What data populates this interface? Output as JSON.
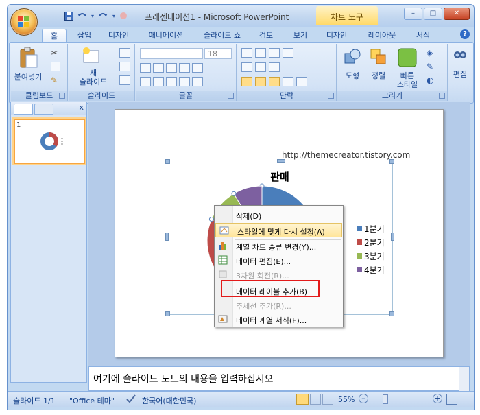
{
  "app": {
    "title": "프레젠테이션1 - Microsoft PowerPoint",
    "context_tab_title": "차트 도구",
    "win_min": "–",
    "win_max": "□",
    "win_close": "✕"
  },
  "tabs": [
    "홈",
    "삽입",
    "디자인",
    "애니메이션",
    "슬라이드 쇼",
    "검토",
    "보기",
    "디자인",
    "레이아웃",
    "서식"
  ],
  "ribbon": {
    "paste_label": "붙여넣기",
    "new_slide_label_1": "새",
    "new_slide_label_2": "슬라이드",
    "font_size_value": "18",
    "shape_label": "도형",
    "arrange_label": "정렬",
    "quick_style_label_1": "빠른",
    "quick_style_label_2": "스타일",
    "edit_label": "편집",
    "groups": {
      "clipboard": "클립보드",
      "slides": "슬라이드",
      "font": "글꼴",
      "paragraph": "단락",
      "drawing": "그리기"
    }
  },
  "slide_pane": {
    "close": "x",
    "thumb_number": "1"
  },
  "slide": {
    "url_text": "http://themecreator.tistory.com",
    "chart": {
      "title": "판매",
      "legend": [
        "1분기",
        "2분기",
        "3분기",
        "4분기"
      ],
      "colors": [
        "#4a7ebb",
        "#be4b48",
        "#98b954",
        "#7d60a0"
      ]
    }
  },
  "chart_data": {
    "type": "pie",
    "title": "판매",
    "categories": [
      "1분기",
      "2분기",
      "3분기",
      "4분기"
    ],
    "values": [
      8.2,
      3.2,
      1.4,
      1.2
    ],
    "legend_position": "right"
  },
  "context_menu": {
    "items": [
      {
        "label": "삭제(D)",
        "disabled": false,
        "highlight": false
      },
      {
        "label": "스타일에 맞게 다시 설정(A)",
        "disabled": false,
        "highlight": true
      },
      {
        "label": "계열 차트 종류 변경(Y)...",
        "disabled": false,
        "highlight": false
      },
      {
        "label": "데이터 편집(E)...",
        "disabled": false,
        "highlight": false
      },
      {
        "label": "3차원 회전(R)...",
        "disabled": true,
        "highlight": false
      },
      {
        "label": "데이터 레이블 추가(B)",
        "disabled": false,
        "highlight": false
      },
      {
        "label": "추세선 추가(R)...",
        "disabled": true,
        "highlight": false
      },
      {
        "label": "데이터 계열 서식(F)...",
        "disabled": false,
        "highlight": false
      }
    ]
  },
  "notes": {
    "placeholder": "여기에 슬라이드 노트의 내용을 입력하십시오"
  },
  "status": {
    "slide_count": "슬라이드 1/1",
    "theme": "\"Office 테마\"",
    "language": "한국어(대한민국)",
    "zoom": "55%"
  }
}
